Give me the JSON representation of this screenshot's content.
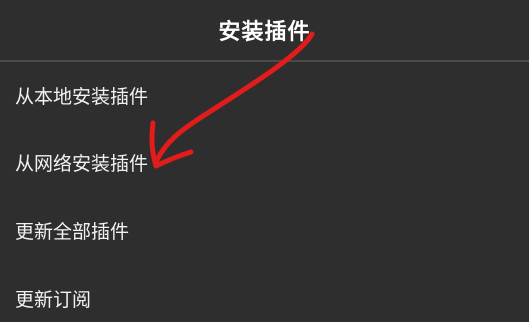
{
  "dialog": {
    "title": "安装插件"
  },
  "menu": {
    "items": [
      {
        "label": "从本地安装插件"
      },
      {
        "label": "从网络安装插件"
      },
      {
        "label": "更新全部插件"
      },
      {
        "label": "更新订阅"
      }
    ]
  },
  "annotation": {
    "type": "arrow",
    "color": "#e21b1b"
  }
}
